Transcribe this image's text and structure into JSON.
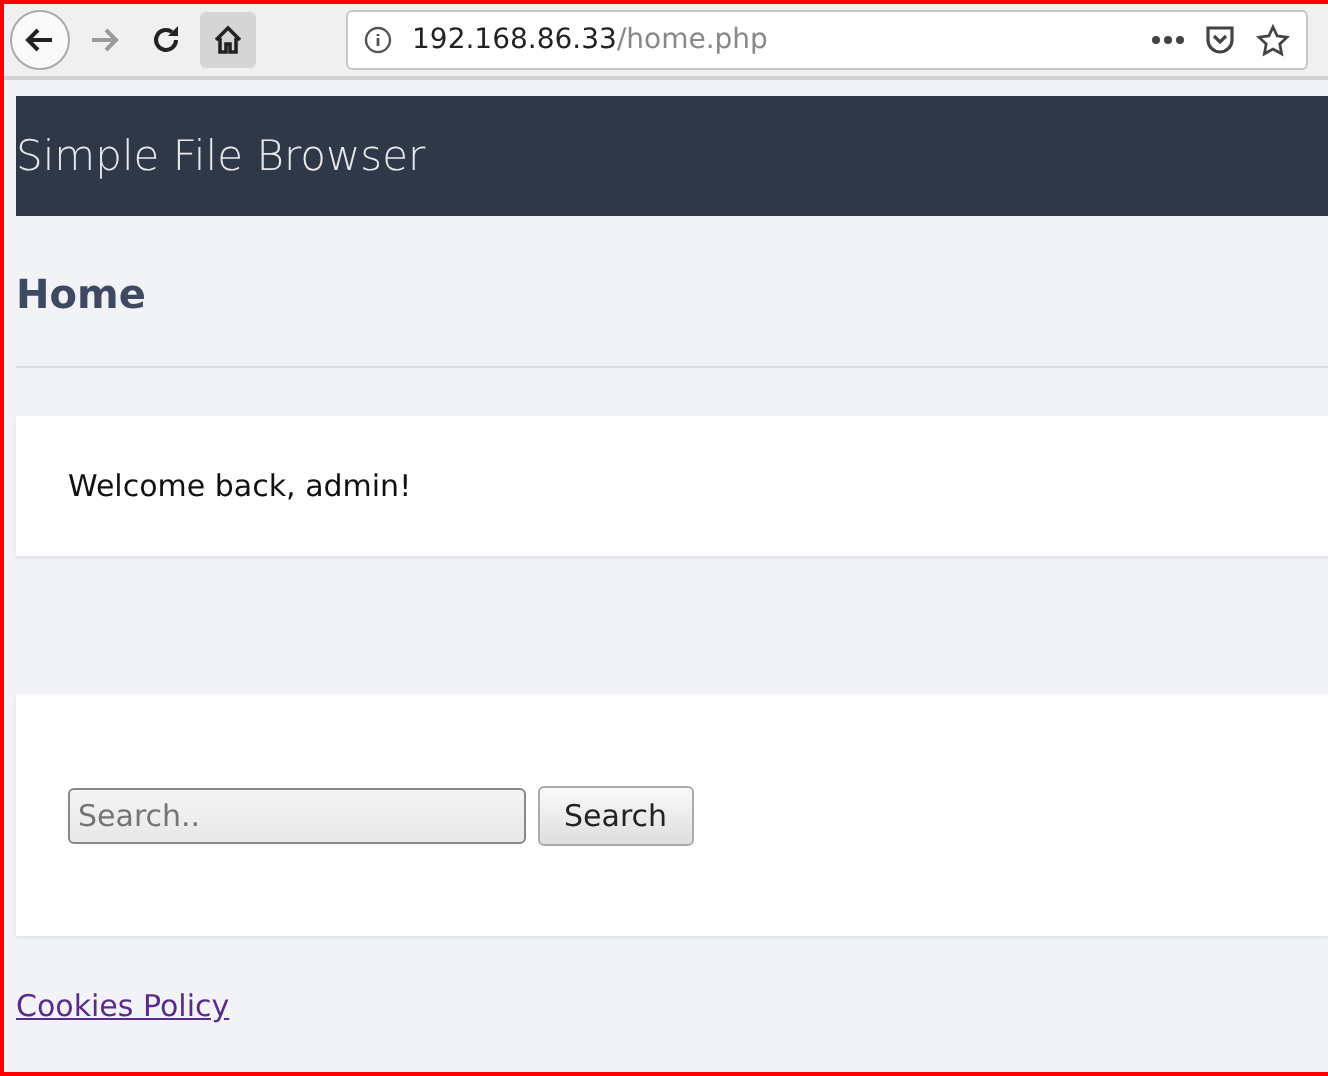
{
  "browser": {
    "nav_buttons": [
      {
        "kind": "back",
        "disabled": false
      },
      {
        "kind": "forward",
        "disabled": true
      },
      {
        "kind": "reload",
        "disabled": false
      },
      {
        "kind": "home",
        "disabled": false
      }
    ],
    "url": {
      "host": "192.168.86.33",
      "path": "/home.php"
    }
  },
  "header": {
    "title": "Simple File Browser"
  },
  "page_title": "Home",
  "welcome": "Welcome back, admin!",
  "search": {
    "placeholder": "Search..",
    "button": "Search"
  },
  "footer_link": "Cookies Policy"
}
